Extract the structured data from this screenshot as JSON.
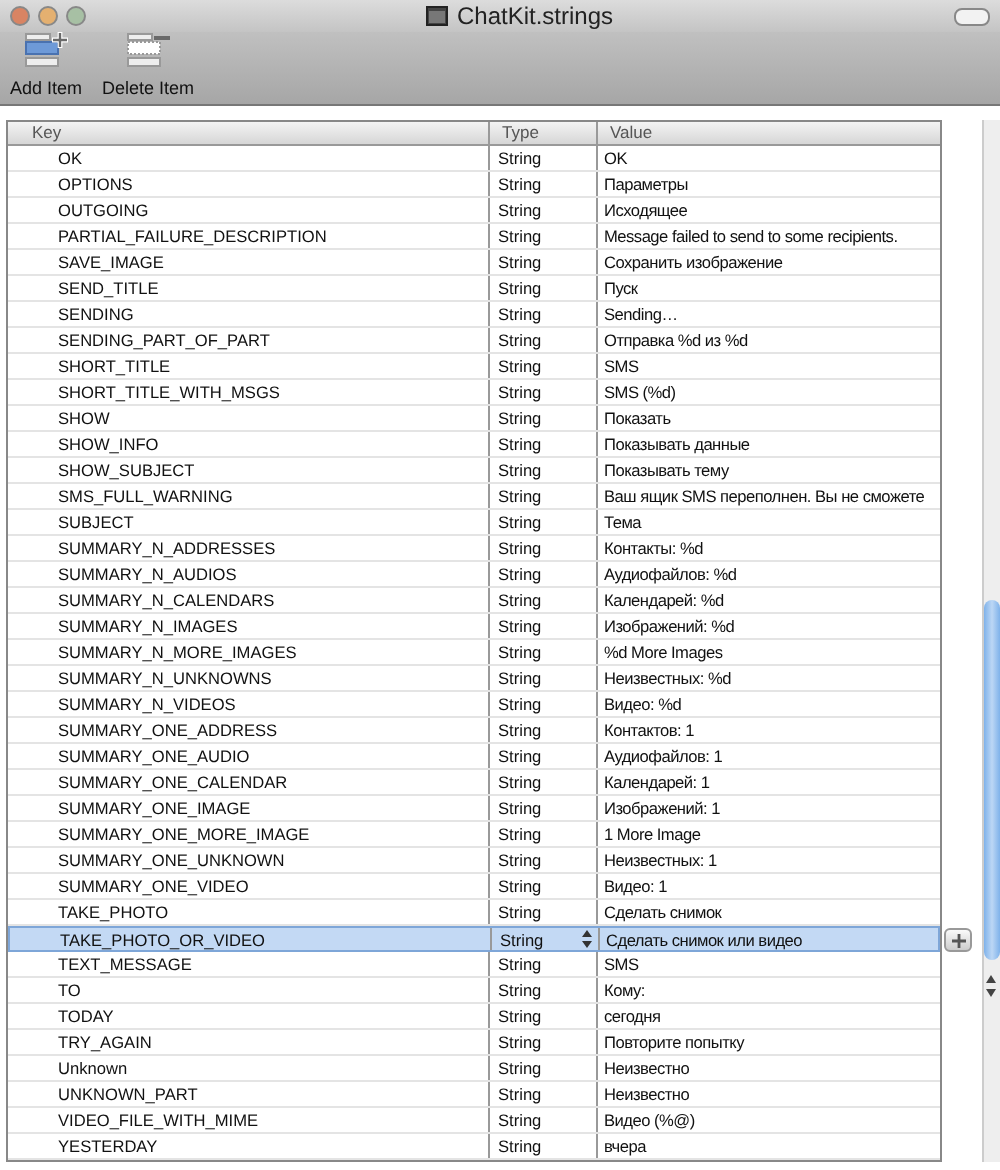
{
  "window": {
    "title": "ChatKit.strings"
  },
  "toolbar": [
    {
      "label": "Add Item",
      "kind": "add"
    },
    {
      "label": "Delete Item",
      "kind": "delete"
    }
  ],
  "table": {
    "columns": [
      "Key",
      "Type",
      "Value"
    ],
    "rows": [
      {
        "key": "OK",
        "type": "String",
        "value": "OK",
        "selected": false
      },
      {
        "key": "OPTIONS",
        "type": "String",
        "value": "Параметры",
        "selected": false
      },
      {
        "key": "OUTGOING",
        "type": "String",
        "value": "Исходящее",
        "selected": false
      },
      {
        "key": "PARTIAL_FAILURE_DESCRIPTION",
        "type": "String",
        "value": "Message failed to send to some recipients.",
        "selected": false
      },
      {
        "key": "SAVE_IMAGE",
        "type": "String",
        "value": "Сохранить изображение",
        "selected": false
      },
      {
        "key": "SEND_TITLE",
        "type": "String",
        "value": "Пуск",
        "selected": false
      },
      {
        "key": "SENDING",
        "type": "String",
        "value": "Sending…",
        "selected": false
      },
      {
        "key": "SENDING_PART_OF_PART",
        "type": "String",
        "value": "Отправка %d из %d",
        "selected": false
      },
      {
        "key": "SHORT_TITLE",
        "type": "String",
        "value": "SMS",
        "selected": false
      },
      {
        "key": "SHORT_TITLE_WITH_MSGS",
        "type": "String",
        "value": "SMS (%d)",
        "selected": false
      },
      {
        "key": "SHOW",
        "type": "String",
        "value": "Показать",
        "selected": false
      },
      {
        "key": "SHOW_INFO",
        "type": "String",
        "value": "Показывать данные",
        "selected": false
      },
      {
        "key": "SHOW_SUBJECT",
        "type": "String",
        "value": "Показывать тему",
        "selected": false
      },
      {
        "key": "SMS_FULL_WARNING",
        "type": "String",
        "value": "Ваш ящик SMS переполнен. Вы не сможете",
        "selected": false
      },
      {
        "key": "SUBJECT",
        "type": "String",
        "value": "Тема",
        "selected": false
      },
      {
        "key": "SUMMARY_N_ADDRESSES",
        "type": "String",
        "value": "Контакты: %d",
        "selected": false
      },
      {
        "key": "SUMMARY_N_AUDIOS",
        "type": "String",
        "value": "Аудиофайлов: %d",
        "selected": false
      },
      {
        "key": "SUMMARY_N_CALENDARS",
        "type": "String",
        "value": "Календарей: %d",
        "selected": false
      },
      {
        "key": "SUMMARY_N_IMAGES",
        "type": "String",
        "value": "Изображений: %d",
        "selected": false
      },
      {
        "key": "SUMMARY_N_MORE_IMAGES",
        "type": "String",
        "value": "%d More Images",
        "selected": false
      },
      {
        "key": "SUMMARY_N_UNKNOWNS",
        "type": "String",
        "value": "Неизвестных: %d",
        "selected": false
      },
      {
        "key": "SUMMARY_N_VIDEOS",
        "type": "String",
        "value": "Видео: %d",
        "selected": false
      },
      {
        "key": "SUMMARY_ONE_ADDRESS",
        "type": "String",
        "value": "Контактов: 1",
        "selected": false
      },
      {
        "key": "SUMMARY_ONE_AUDIO",
        "type": "String",
        "value": "Аудиофайлов: 1",
        "selected": false
      },
      {
        "key": "SUMMARY_ONE_CALENDAR",
        "type": "String",
        "value": "Календарей: 1",
        "selected": false
      },
      {
        "key": "SUMMARY_ONE_IMAGE",
        "type": "String",
        "value": "Изображений: 1",
        "selected": false
      },
      {
        "key": "SUMMARY_ONE_MORE_IMAGE",
        "type": "String",
        "value": "1 More Image",
        "selected": false
      },
      {
        "key": "SUMMARY_ONE_UNKNOWN",
        "type": "String",
        "value": "Неизвестных: 1",
        "selected": false
      },
      {
        "key": "SUMMARY_ONE_VIDEO",
        "type": "String",
        "value": "Видео: 1",
        "selected": false
      },
      {
        "key": "TAKE_PHOTO",
        "type": "String",
        "value": "Сделать снимок",
        "selected": false
      },
      {
        "key": "TAKE_PHOTO_OR_VIDEO",
        "type": "String",
        "value": "Сделать снимок или видео",
        "selected": true
      },
      {
        "key": "TEXT_MESSAGE",
        "type": "String",
        "value": "SMS",
        "selected": false
      },
      {
        "key": "TO",
        "type": "String",
        "value": "Кому:",
        "selected": false
      },
      {
        "key": "TODAY",
        "type": "String",
        "value": "сегодня",
        "selected": false
      },
      {
        "key": "TRY_AGAIN",
        "type": "String",
        "value": "Повторите попытку",
        "selected": false
      },
      {
        "key": "Unknown",
        "type": "String",
        "value": "Неизвестно",
        "selected": false
      },
      {
        "key": "UNKNOWN_PART",
        "type": "String",
        "value": "Неизвестно",
        "selected": false
      },
      {
        "key": "VIDEO_FILE_WITH_MIME",
        "type": "String",
        "value": "Видео (%@)",
        "selected": false
      },
      {
        "key": "YESTERDAY",
        "type": "String",
        "value": "вчера",
        "selected": false
      }
    ]
  }
}
